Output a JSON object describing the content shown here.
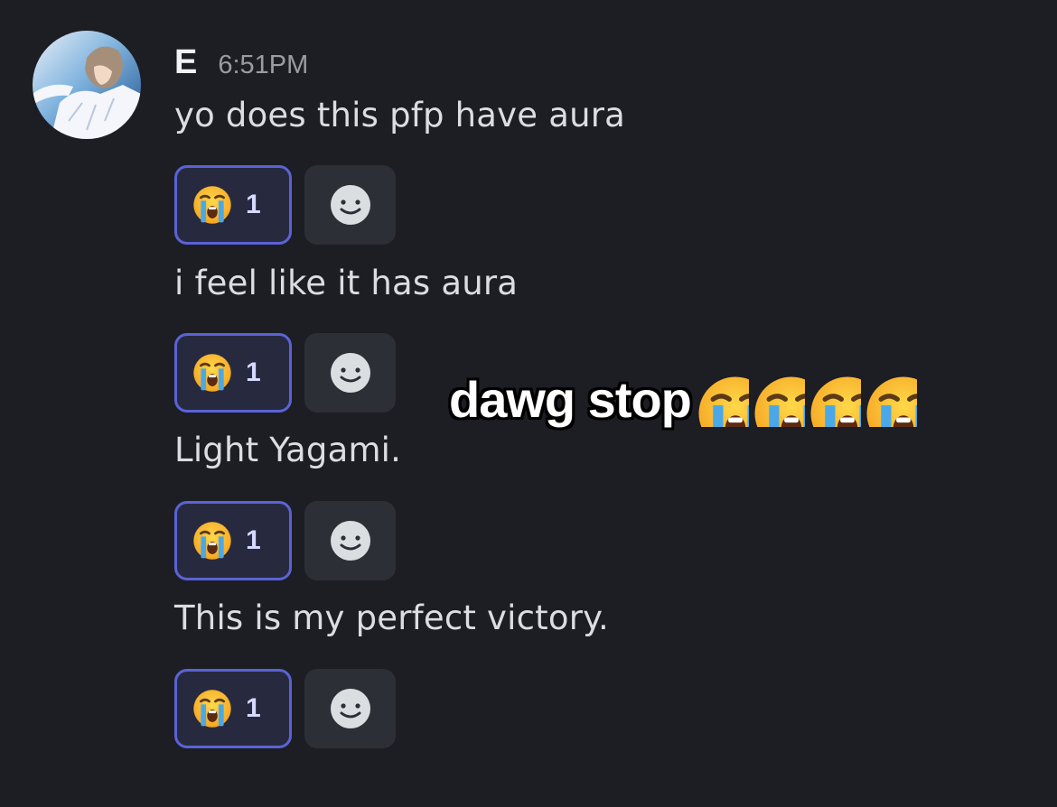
{
  "message_group": {
    "author": "E",
    "timestamp": "6:51PM",
    "avatar_icon": "anime-character-avatar",
    "messages": [
      {
        "text": "yo does this pfp have aura",
        "reaction": {
          "emoji": "loudly-crying-face",
          "count": "1"
        }
      },
      {
        "text": "i feel like it has aura",
        "reaction": {
          "emoji": "loudly-crying-face",
          "count": "1"
        }
      },
      {
        "text": "Light Yagami.",
        "reaction": {
          "emoji": "loudly-crying-face",
          "count": "1"
        }
      },
      {
        "text": "This is my perfect victory.",
        "reaction": {
          "emoji": "loudly-crying-face",
          "count": "1"
        }
      }
    ],
    "add_reaction_icon": "smiley-face-icon"
  },
  "overlay": {
    "caption": "dawg stop",
    "emoji": "loudly-crying-face",
    "emoji_count": 4
  },
  "colors": {
    "background": "#1d1e24",
    "reaction_border": "#5a63d6",
    "reaction_bg": "#272a3e"
  }
}
